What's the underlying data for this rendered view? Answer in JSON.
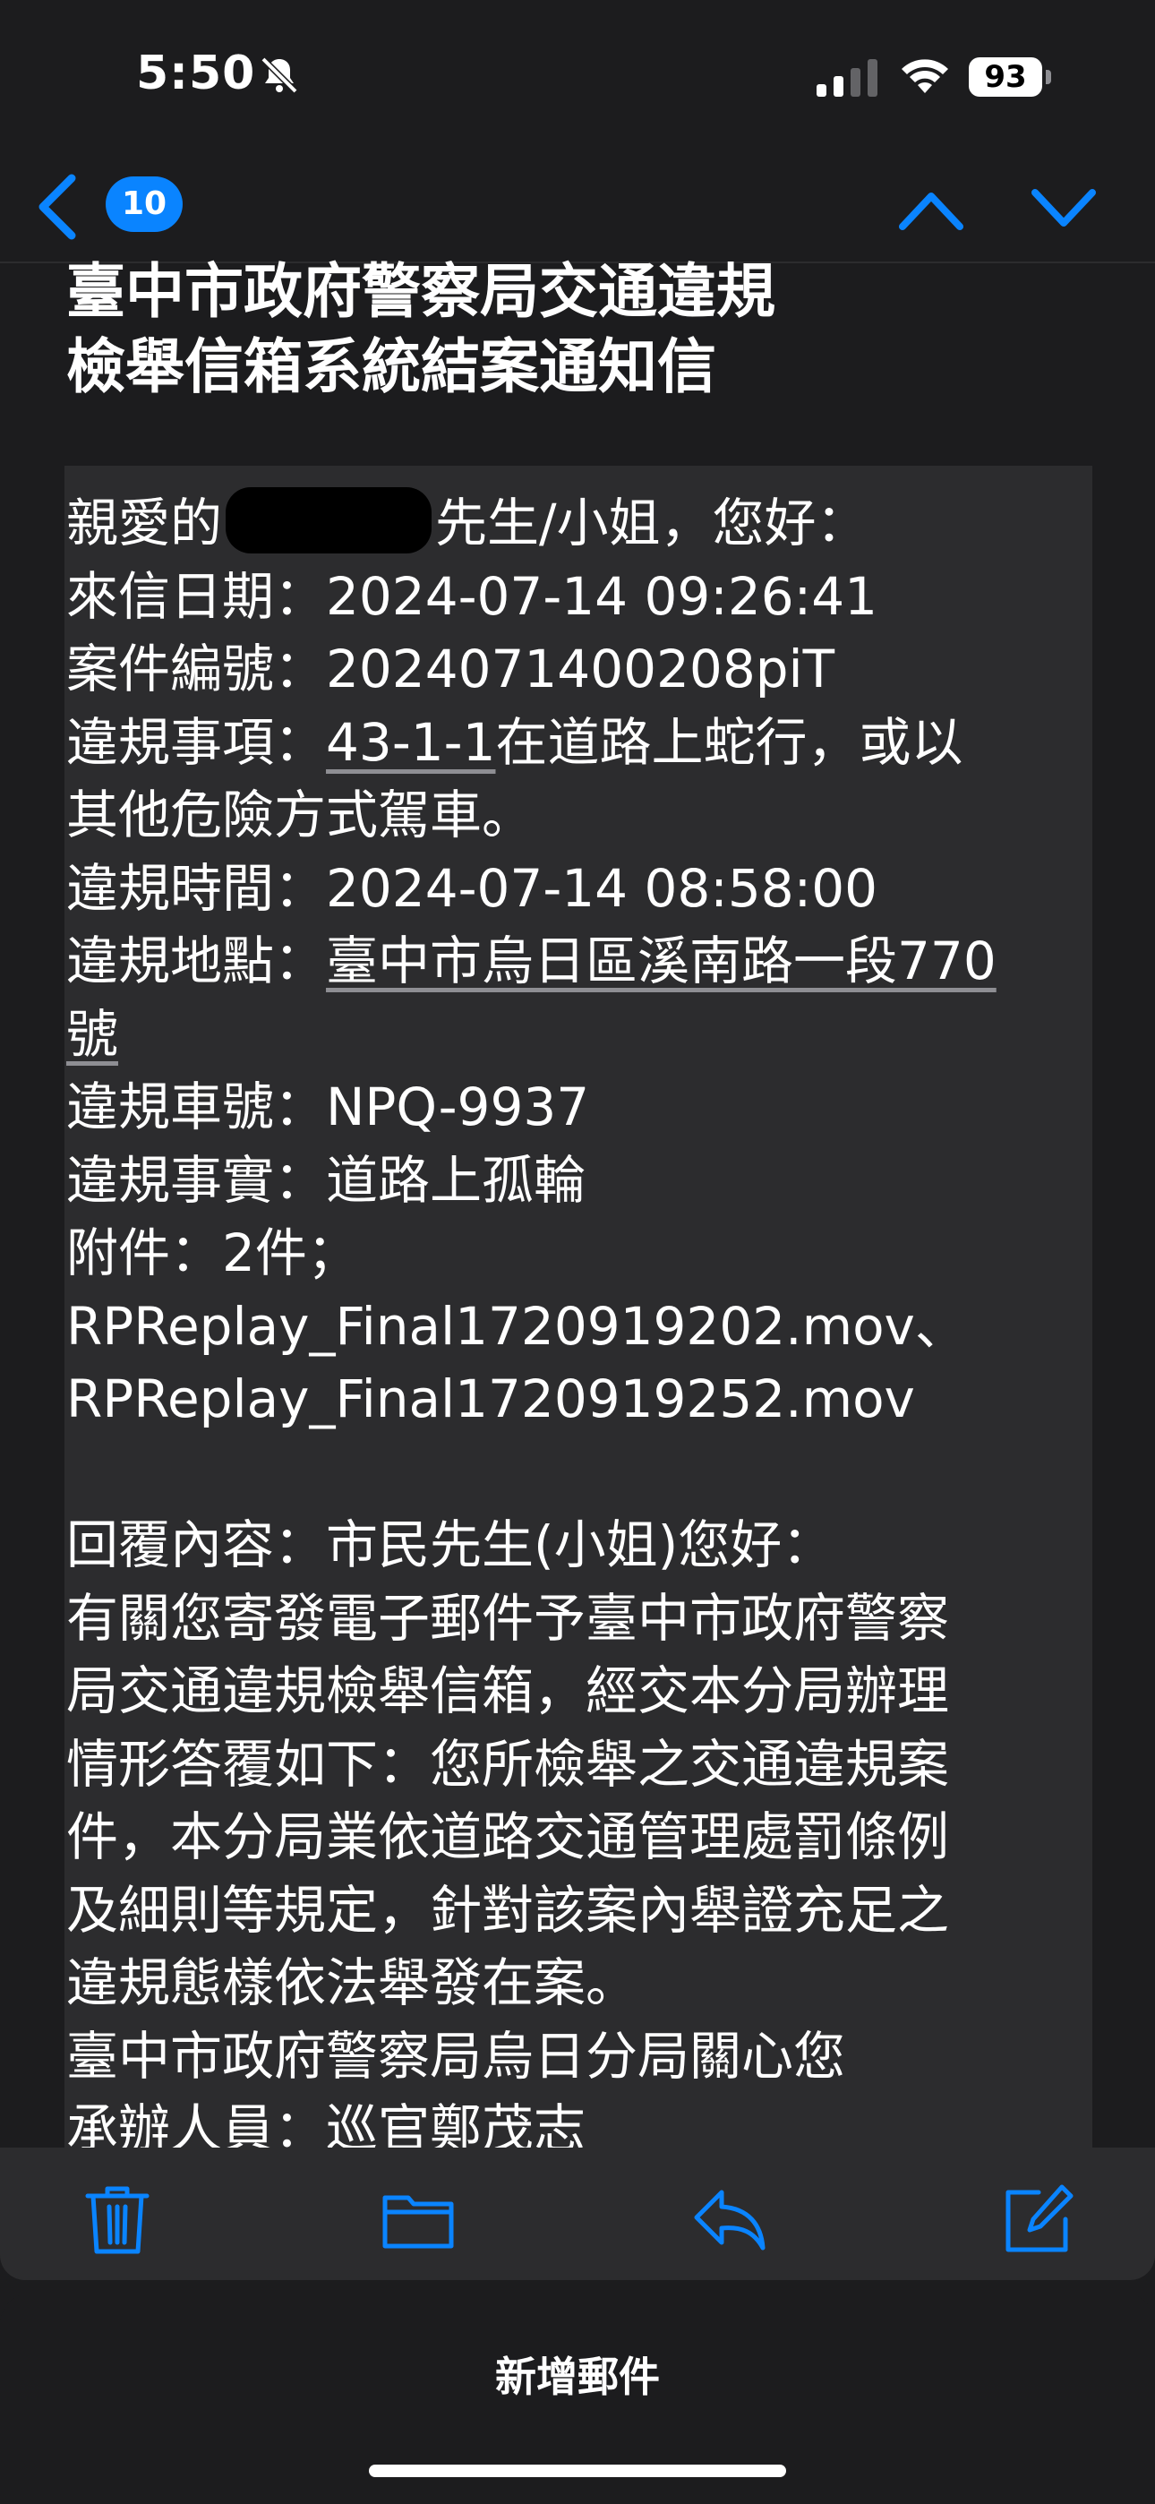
{
  "status_bar": {
    "time": "5:50",
    "battery": "93"
  },
  "nav": {
    "unread_count": "10"
  },
  "email": {
    "subject": "臺中市政府警察局交通違規\n檢舉信箱系統結案通知信",
    "greeting_prefix": "親愛的",
    "greeting_suffix": "先生/小姐，您好：",
    "lines": {
      "date": "來信日期：2024-07-14 09:26:41",
      "case_no": "案件編號：2024071400208piT",
      "item_label": "違規事項：",
      "item_link": "43-1-1",
      "item_rest": "在道路上蛇行，或以",
      "item_cont": "其他危險方式駕車。",
      "time": "違規時間：2024-07-14 08:58:00",
      "place_label": "違規地點：",
      "place_link": "臺中市烏日區溪南路一段770",
      "place_cont": "號",
      "plate": "違規車號：NPQ-9937",
      "fact": "違規事實：道路上孤輪",
      "attach": "附件：2件；",
      "file1": "RPReplay_Final1720919202.mov、",
      "file2": "RPReplay_Final1720919252.mov",
      "reply_1": "回覆內容：市民先生(小姐)您好：",
      "reply_2": "有關您寄發電子郵件予臺中市政府警察",
      "reply_3": "局交通違規檢舉信箱，經交本分局辦理",
      "reply_4": "情形答覆如下：您所檢舉之交通違規案",
      "reply_5": "件，本分局業依道路交通管理處罰條例",
      "reply_6": "及細則等規定，針對該案內舉證充足之",
      "reply_7": "違規態樣依法舉發在案。",
      "reply_8": "臺中市政府警察局烏日分局關心您",
      "reply_9": "承辦人員：巡官鄭茂志"
    }
  },
  "sheet": {
    "title": "新增郵件"
  },
  "colors": {
    "accent": "#0a84ff",
    "background": "#1c1c1e",
    "panel": "#2c2c2e"
  }
}
